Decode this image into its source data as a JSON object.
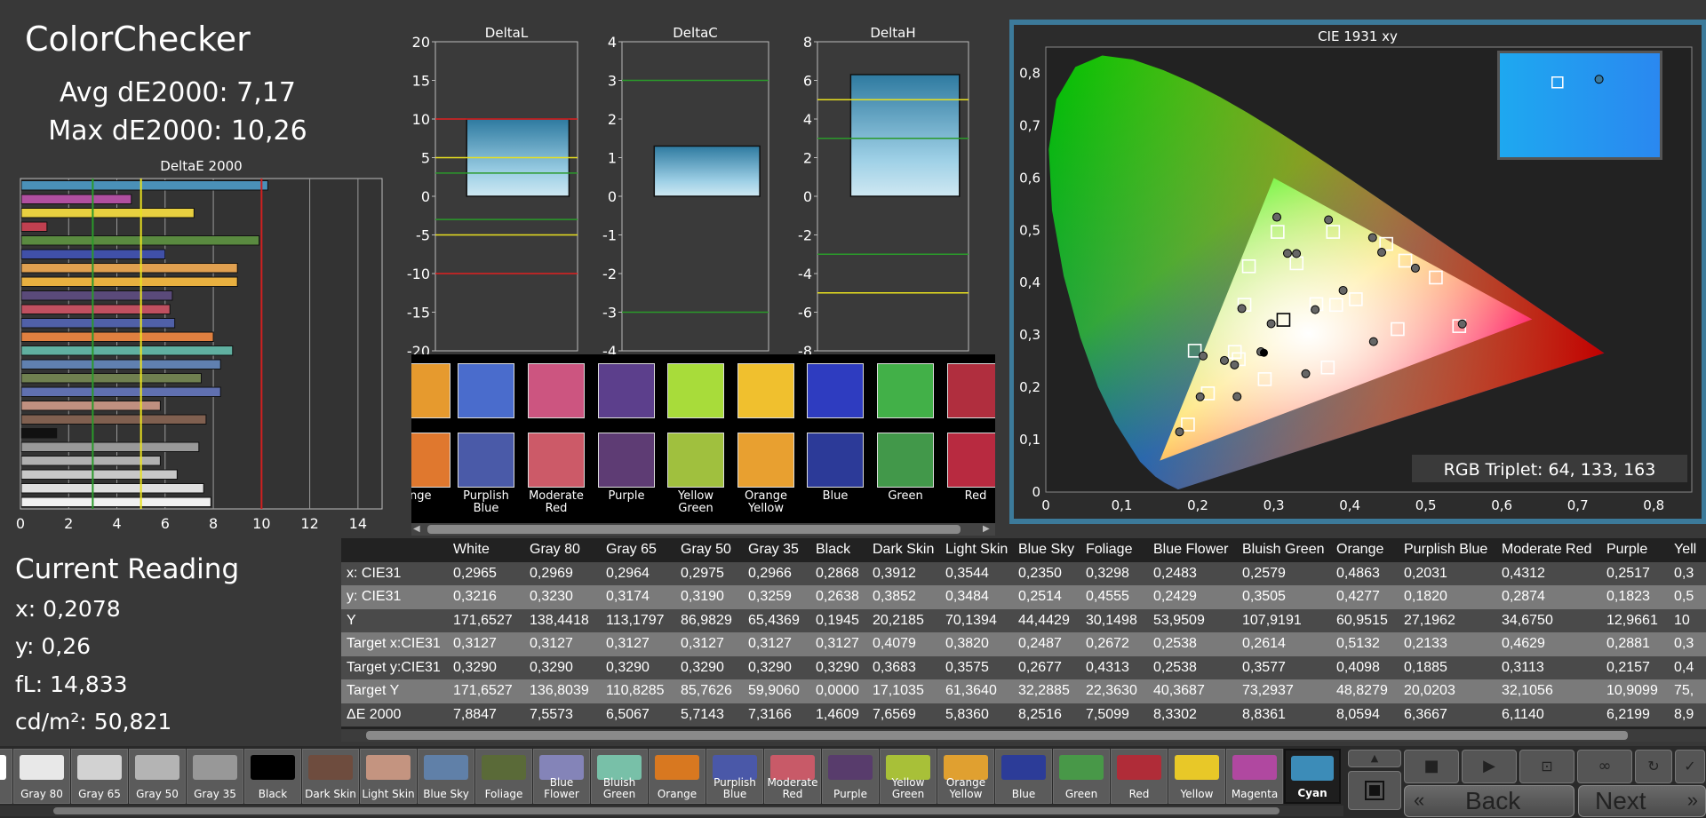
{
  "title": "ColorChecker",
  "avg_label": "Avg dE2000: 7,17",
  "max_label": "Max dE2000: 10,26",
  "current": {
    "title": "Current Reading",
    "x": "x: 0,2078",
    "y": "y: 0,26",
    "fl": "fL: 14,833",
    "cdm2": "cd/m²: 50,821"
  },
  "rgb_triplet": "RGB Triplet: 64, 133, 163",
  "chart_data": [
    {
      "type": "bar",
      "orientation": "horizontal",
      "title": "DeltaE 2000",
      "xlim": [
        0,
        15
      ],
      "xticks": [
        "0",
        "2",
        "4",
        "6",
        "8",
        "10",
        "12",
        "14"
      ],
      "reference_lines": [
        3,
        5,
        10
      ],
      "values": [
        10.26,
        4.6,
        7.2,
        1.1,
        9.9,
        6.0,
        9.0,
        9.0,
        6.3,
        6.2,
        6.4,
        8.0,
        8.8,
        8.3,
        7.5,
        8.3,
        5.8,
        7.7,
        1.5,
        7.4,
        5.8,
        6.5,
        7.6,
        7.9
      ],
      "colors": [
        "#4a90b8",
        "#b04fa0",
        "#e8d040",
        "#c04050",
        "#5a8a40",
        "#4050a8",
        "#e0a050",
        "#e8b040",
        "#5a4a7a",
        "#c05060",
        "#5060a8",
        "#e08040",
        "#60b0a0",
        "#6080b0",
        "#708050",
        "#6070b0",
        "#c09080",
        "#806050",
        "#111111",
        "#999999",
        "#b0b0b0",
        "#c8c8c8",
        "#e0e0e0",
        "#f0f0f0"
      ]
    },
    {
      "type": "bar",
      "title": "DeltaL",
      "ylim": [
        -20,
        20
      ],
      "yticks": [
        "20",
        "15",
        "10",
        "5",
        "0",
        "-5",
        "-10",
        "-15",
        "-20"
      ],
      "values": [
        10
      ]
    },
    {
      "type": "bar",
      "title": "DeltaC",
      "ylim": [
        -4,
        4
      ],
      "yticks": [
        "4",
        "3",
        "2",
        "1",
        "0",
        "-1",
        "-2",
        "-3",
        "-4"
      ],
      "values": [
        1.3
      ]
    },
    {
      "type": "bar",
      "title": "DeltaH",
      "ylim": [
        -8,
        8
      ],
      "yticks": [
        "8",
        "6",
        "4",
        "2",
        "0",
        "-2",
        "-4",
        "-6",
        "-8"
      ],
      "values": [
        6.3
      ]
    },
    {
      "type": "scatter",
      "title": "CIE 1931 xy",
      "xlim": [
        0,
        0.85
      ],
      "ylim": [
        0,
        0.85
      ],
      "xticks": [
        "0",
        "0,1",
        "0,2",
        "0,3",
        "0,4",
        "0,5",
        "0,6",
        "0,7",
        "0,8"
      ],
      "yticks": [
        "0",
        "0,1",
        "0,2",
        "0,3",
        "0,4",
        "0,5",
        "0,6",
        "0,7",
        "0,8"
      ],
      "targets": [
        [
          0.3127,
          0.329
        ],
        [
          0.4079,
          0.3683
        ],
        [
          0.382,
          0.3575
        ],
        [
          0.2487,
          0.2677
        ],
        [
          0.2672,
          0.4313
        ],
        [
          0.2538,
          0.2538
        ],
        [
          0.2614,
          0.3577
        ],
        [
          0.5132,
          0.4098
        ],
        [
          0.2133,
          0.1885
        ],
        [
          0.4629,
          0.3113
        ],
        [
          0.2881,
          0.2157
        ],
        [
          0.378,
          0.497
        ],
        [
          0.473,
          0.442
        ],
        [
          0.187,
          0.129
        ],
        [
          0.305,
          0.497
        ],
        [
          0.544,
          0.317
        ],
        [
          0.448,
          0.474
        ],
        [
          0.371,
          0.238
        ],
        [
          0.196,
          0.27
        ],
        [
          0.33,
          0.437
        ],
        [
          0.356,
          0.359
        ]
      ],
      "measured": [
        [
          0.2965,
          0.3216
        ],
        [
          0.3912,
          0.3852
        ],
        [
          0.3544,
          0.3484
        ],
        [
          0.235,
          0.2514
        ],
        [
          0.3298,
          0.4555
        ],
        [
          0.2483,
          0.2429
        ],
        [
          0.2579,
          0.3505
        ],
        [
          0.4863,
          0.4277
        ],
        [
          0.2031,
          0.182
        ],
        [
          0.4312,
          0.2874
        ],
        [
          0.2517,
          0.1823
        ],
        [
          0.372,
          0.52
        ],
        [
          0.442,
          0.458
        ],
        [
          0.176,
          0.115
        ],
        [
          0.304,
          0.525
        ],
        [
          0.548,
          0.321
        ],
        [
          0.43,
          0.486
        ],
        [
          0.342,
          0.226
        ],
        [
          0.207,
          0.26
        ],
        [
          0.318,
          0.456
        ],
        [
          0.283,
          0.268
        ]
      ],
      "inset": {
        "target": [
          0.36,
          0.28
        ],
        "measured": [
          0.62,
          0.25
        ]
      }
    }
  ],
  "swatches_row1": [
    "#e69a2e",
    "#4a6ccc",
    "#cc5580",
    "#5c3f8c",
    "#a8dc3a",
    "#f0c02e",
    "#2e3cc0",
    "#42b048",
    "#b02e3e"
  ],
  "swatches_row2": [
    "#e0782e",
    "#4a5aa8",
    "#cc5a68",
    "#5e3c74",
    "#a0c03e",
    "#e8a030",
    "#2c3a98",
    "#42984a",
    "#b82a40"
  ],
  "swatch_labels": [
    "ange",
    "Purplish Blue",
    "Moderate Red",
    "Purple",
    "Yellow Green",
    "Orange Yellow",
    "Blue",
    "Green",
    "Red"
  ],
  "table": {
    "columns": [
      "White",
      "Gray 80",
      "Gray 65",
      "Gray 50",
      "Gray 35",
      "Black",
      "Dark Skin",
      "Light Skin",
      "Blue Sky",
      "Foliage",
      "Blue Flower",
      "Bluish Green",
      "Orange",
      "Purplish Blue",
      "Moderate Red",
      "Purple",
      "Yell"
    ],
    "rows": [
      {
        "label": "x: CIE31",
        "values": [
          "0,2965",
          "0,2969",
          "0,2964",
          "0,2975",
          "0,2966",
          "0,2868",
          "0,3912",
          "0,3544",
          "0,2350",
          "0,3298",
          "0,2483",
          "0,2579",
          "0,4863",
          "0,2031",
          "0,4312",
          "0,2517",
          "0,3"
        ]
      },
      {
        "label": "y: CIE31",
        "values": [
          "0,3216",
          "0,3230",
          "0,3174",
          "0,3190",
          "0,3259",
          "0,2638",
          "0,3852",
          "0,3484",
          "0,2514",
          "0,4555",
          "0,2429",
          "0,3505",
          "0,4277",
          "0,1820",
          "0,2874",
          "0,1823",
          "0,5"
        ]
      },
      {
        "label": "Y",
        "values": [
          "171,6527",
          "138,4418",
          "113,1797",
          "86,9829",
          "65,4369",
          "0,1945",
          "20,2185",
          "70,1394",
          "44,4429",
          "30,1498",
          "53,9509",
          "107,9191",
          "60,9515",
          "27,1962",
          "34,6750",
          "12,9661",
          "10"
        ]
      },
      {
        "label": "Target x:CIE31",
        "values": [
          "0,3127",
          "0,3127",
          "0,3127",
          "0,3127",
          "0,3127",
          "0,3127",
          "0,4079",
          "0,3820",
          "0,2487",
          "0,2672",
          "0,2538",
          "0,2614",
          "0,5132",
          "0,2133",
          "0,4629",
          "0,2881",
          "0,3"
        ]
      },
      {
        "label": "Target y:CIE31",
        "values": [
          "0,3290",
          "0,3290",
          "0,3290",
          "0,3290",
          "0,3290",
          "0,3290",
          "0,3683",
          "0,3575",
          "0,2677",
          "0,4313",
          "0,2538",
          "0,3577",
          "0,4098",
          "0,1885",
          "0,3113",
          "0,2157",
          "0,4"
        ]
      },
      {
        "label": "Target Y",
        "values": [
          "171,6527",
          "136,8039",
          "110,8285",
          "85,7626",
          "59,9060",
          "0,0000",
          "17,1035",
          "61,3640",
          "32,2885",
          "22,3630",
          "40,3687",
          "73,2937",
          "48,8279",
          "20,0203",
          "32,1056",
          "10,9099",
          "75,"
        ]
      },
      {
        "label": "ΔE 2000",
        "values": [
          "7,8847",
          "7,5573",
          "6,5067",
          "5,7143",
          "7,3166",
          "1,4609",
          "7,6569",
          "5,8360",
          "8,2516",
          "7,5099",
          "8,3302",
          "8,8361",
          "8,0594",
          "6,3667",
          "6,1140",
          "6,2199",
          "8,9"
        ]
      }
    ],
    "col_widths": [
      86,
      86,
      84,
      76,
      76,
      64,
      82,
      82,
      76,
      76,
      100,
      106,
      76,
      110,
      118,
      76,
      40
    ]
  },
  "patch_tabs": [
    {
      "label": "e",
      "color": "#ffffff"
    },
    {
      "label": "Gray 80",
      "color": "#e8e8e8"
    },
    {
      "label": "Gray 65",
      "color": "#d2d2d2"
    },
    {
      "label": "Gray 50",
      "color": "#b4b4b4"
    },
    {
      "label": "Gray 35",
      "color": "#989898"
    },
    {
      "label": "Black",
      "color": "#000000"
    },
    {
      "label": "Dark Skin",
      "color": "#6e4c3e"
    },
    {
      "label": "Light Skin",
      "color": "#c49480"
    },
    {
      "label": "Blue Sky",
      "color": "#6080a8"
    },
    {
      "label": "Foliage",
      "color": "#5a6a38"
    },
    {
      "label": "Blue Flower",
      "color": "#8484b8"
    },
    {
      "label": "Bluish Green",
      "color": "#78c0a8"
    },
    {
      "label": "Orange",
      "color": "#d87820"
    },
    {
      "label": "Purplish Blue",
      "color": "#4a58a8"
    },
    {
      "label": "Moderate Red",
      "color": "#c85a68"
    },
    {
      "label": "Purple",
      "color": "#583c6c"
    },
    {
      "label": "Yellow Green",
      "color": "#a8c038"
    },
    {
      "label": "Orange Yellow",
      "color": "#e0a030"
    },
    {
      "label": "Blue",
      "color": "#2c3c98"
    },
    {
      "label": "Green",
      "color": "#489848"
    },
    {
      "label": "Red",
      "color": "#b02c38"
    },
    {
      "label": "Yellow",
      "color": "#e8c828"
    },
    {
      "label": "Magenta",
      "color": "#b048a0"
    },
    {
      "label": "Cyan",
      "color": "#3c8cb8"
    }
  ],
  "nav": {
    "back": "Back",
    "next": "Next"
  }
}
